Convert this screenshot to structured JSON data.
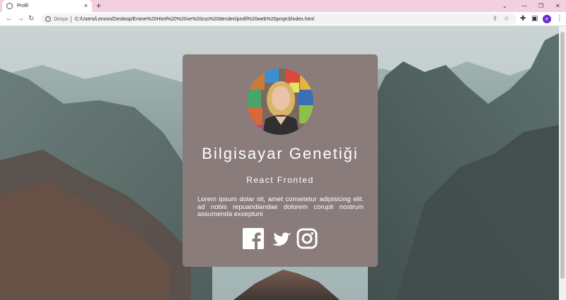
{
  "browser": {
    "tab_title": "Profil",
    "tab_close": "×",
    "new_tab": "+",
    "scheme_label": "Dosya",
    "url": "C:/Users/Lenovo/Desktop/Emine%20Html%20%20ve%20css%20dersleri/profil%20web%20proje3/index.html",
    "avatar_letter": "e"
  },
  "profile": {
    "name": "Bilgisayar Genetiği",
    "role": "React Fronted",
    "bio": "Lorem ipsum dolar sit, amet consetetur adipisicing elit. ad nobis repuandiandae dolorem corupli nostrum assumenda exxeptuni"
  },
  "social": [
    "facebook-icon",
    "twitter-icon",
    "instagram-icon"
  ],
  "colors": {
    "card": "#8a7c7b",
    "tabstrip": "#f3cfe0",
    "avatar": "#6a2bd1"
  }
}
